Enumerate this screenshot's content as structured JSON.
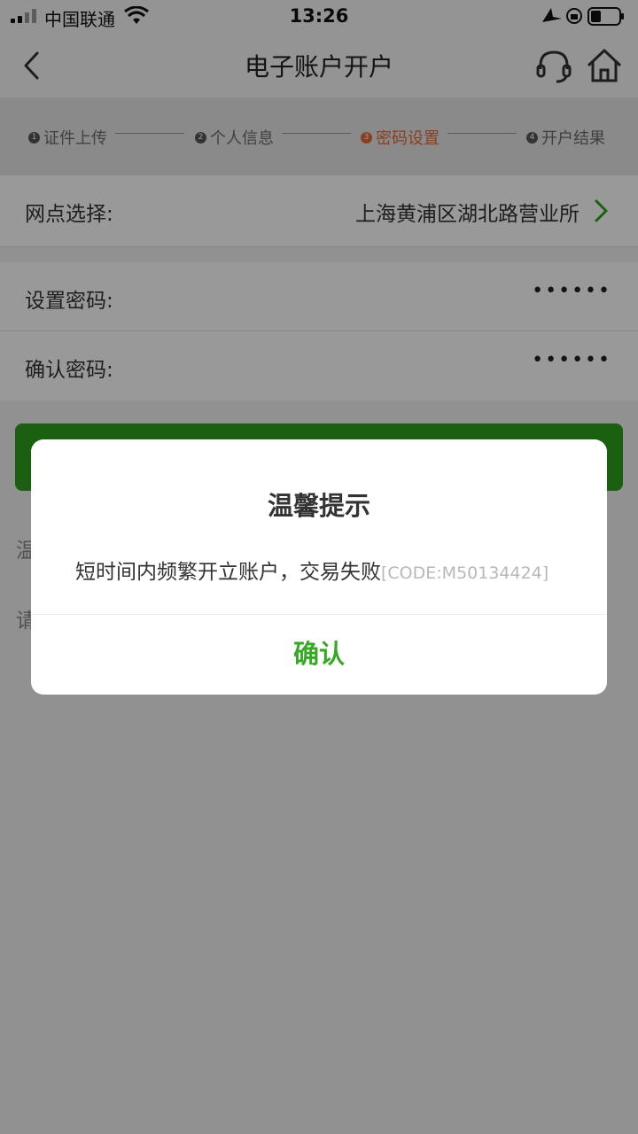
{
  "status_bar": {
    "carrier": "中国联通",
    "time": "13:26"
  },
  "nav": {
    "title": "电子账户开户",
    "icons": [
      "back-icon",
      "headset-icon",
      "home-icon"
    ]
  },
  "steps": [
    {
      "num": "1",
      "label": "证件上传"
    },
    {
      "num": "2",
      "label": "个人信息"
    },
    {
      "num": "3",
      "label": "密码设置"
    },
    {
      "num": "4",
      "label": "开户结果"
    }
  ],
  "active_step": 3,
  "branch": {
    "label": "网点选择:",
    "value": "上海黄浦区湖北路营业所"
  },
  "password": {
    "set_label": "设置密码:",
    "set_value": "••••••",
    "confirm_label": "确认密码:",
    "confirm_value": "••••••"
  },
  "background_text": {
    "tip1": "温",
    "tip2": "请"
  },
  "dialog": {
    "title": "温馨提示",
    "message": "短时间内频繁开立账户，交易失败",
    "code": "[CODE:M50134424]",
    "confirm_label": "确认"
  },
  "colors": {
    "accent_green": "#2ca01c",
    "confirm_green": "#3aa62a",
    "active_step": "#e26a3a"
  }
}
